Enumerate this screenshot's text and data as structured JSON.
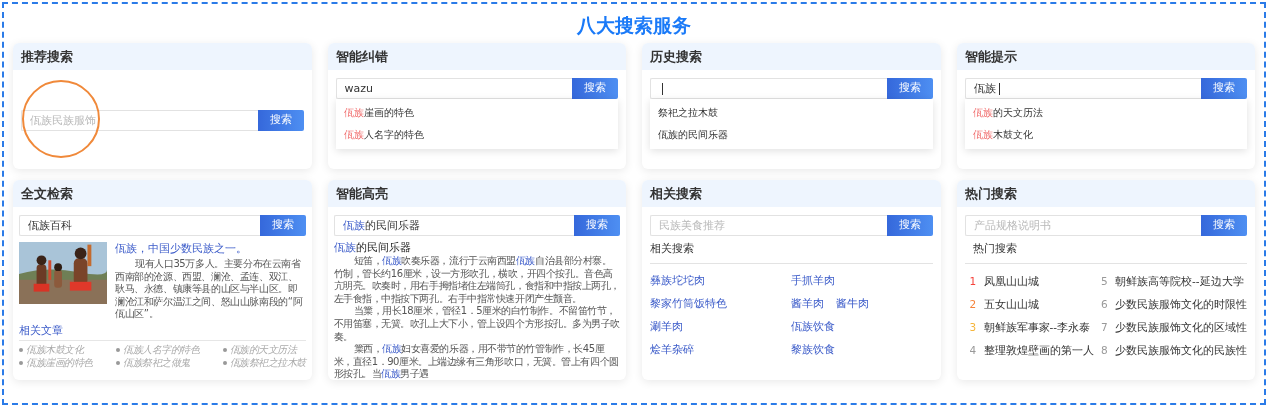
{
  "title": "八大搜索服务",
  "cards": [
    {
      "kind": "recommend",
      "title": "推荐搜索",
      "search": {
        "placeholder": "佤族民族服饰",
        "button": "搜索",
        "circled": true
      }
    },
    {
      "kind": "suggest",
      "title": "智能纠错",
      "search": {
        "value": "wazu",
        "button": "搜索"
      },
      "suggestions": [
        {
          "match": "佤族",
          "text": "崖画的特色"
        },
        {
          "match": "佤族",
          "text": "人名字的特色"
        }
      ]
    },
    {
      "kind": "suggest",
      "title": "历史搜索",
      "search": {
        "button": "搜索",
        "focused": true
      },
      "suggestions": [
        {
          "text": "祭祀之拉木鼓"
        },
        {
          "text": "佤族的民间乐器"
        }
      ]
    },
    {
      "kind": "suggest",
      "title": "智能提示",
      "search": {
        "value": "佤族",
        "button": "搜索",
        "focused": true
      },
      "suggestions": [
        {
          "match": "佤族",
          "text": "的天文历法"
        },
        {
          "match": "佤族",
          "text": "木鼓文化"
        }
      ]
    },
    {
      "kind": "fulltext",
      "title": "全文检索",
      "search": {
        "value": "佤族百科",
        "button": "搜索"
      },
      "result": {
        "title": "佤族，中国少数民族之一。",
        "text": "现有人口35万多人。主要分布在云南省西南部的沧源、西盟、澜沧、孟连、双江、耿马、永德、镇康等县的山区与半山区。即澜沧江和萨尔温江之间、怒山山脉南段的“阿佤山区”。"
      },
      "related_title": "相关文章",
      "articles": [
        "佤族木鼓文化",
        "佤族人名字的特色",
        "佤族的天文历法",
        "佤族崖画的特色",
        "佤族祭祀之做鬼",
        "佤族祭祀之拉木鼓"
      ]
    },
    {
      "kind": "highlight",
      "title": "智能高亮",
      "search": {
        "value_parts": [
          {
            "text": "佤族",
            "hl": true
          },
          {
            "text": "的民间乐器",
            "hl": false
          }
        ],
        "button": "搜索"
      },
      "heading": [
        {
          "text": "佤族",
          "hl": true
        },
        {
          "text": "的民间乐器",
          "hl": false
        }
      ],
      "paragraphs": [
        [
          {
            "text": "短笛，",
            "hl": false
          },
          {
            "text": "佤族",
            "hl": true
          },
          {
            "text": "吹奏乐器，流行于云南西盟",
            "hl": false
          },
          {
            "text": "佤族",
            "hl": true
          },
          {
            "text": "自治县部分村寨。竹制，管长约16厘米，设一方形吹孔，横吹，开四个按孔。音色高亢明亮。吹奏时，用右手拇指堵住左端筒孔，食指和中指按上两孔，左手食指，中指按下两孔。右手中指常快速开闭产生颤音。",
            "hl": false
          }
        ],
        [
          {
            "text": "当篥，用长18厘米，管径1．5厘米的白竹制作。不留笛竹节，不用笛塞，无簧。吹孔上大下小，管上设四个方形按孔。多为男子吹奏。",
            "hl": false
          }
        ],
        [
          {
            "text": "篥西，",
            "hl": false
          },
          {
            "text": "佤族",
            "hl": true
          },
          {
            "text": "妇女喜爱的乐器，用不带节的竹管制作，长45厘米，直径1．90厘米。上端边缘有三角形吹口，无簧。管上有四个圆形按孔。当",
            "hl": false
          },
          {
            "text": "佤族",
            "hl": true
          },
          {
            "text": "男子遇",
            "hl": false
          }
        ]
      ]
    },
    {
      "kind": "related",
      "title": "相关搜索",
      "search": {
        "placeholder": "民族美食推荐",
        "button": "搜索"
      },
      "heading": "相关搜索",
      "rows": [
        [
          [
            "彝族坨坨肉"
          ],
          [
            "手抓羊肉"
          ]
        ],
        [
          [
            "黎家竹筒饭特色"
          ],
          [
            "酱羊肉",
            "酱牛肉"
          ]
        ],
        [
          [
            "涮羊肉"
          ],
          [
            "佤族饮食"
          ]
        ],
        [
          [
            "烩羊杂碎"
          ],
          [
            "黎族饮食"
          ]
        ]
      ]
    },
    {
      "kind": "hot",
      "title": "热门搜索",
      "search": {
        "placeholder": "产品规格说明书",
        "button": "搜索"
      },
      "heading": "热门搜索",
      "items": [
        {
          "rank": "1",
          "text": "凤凰山山城",
          "color": "#f5423b"
        },
        {
          "rank": "2",
          "text": "五女山山城",
          "color": "#f5833b"
        },
        {
          "rank": "3",
          "text": "朝鲜族军事家--李永泰",
          "color": "#f5b53b"
        },
        {
          "rank": "4",
          "text": "整理敦煌壁画的第一人",
          "color": "#999999"
        },
        {
          "rank": "5",
          "text": "朝鲜族高等院校--延边大学",
          "color": "#999999"
        },
        {
          "rank": "6",
          "text": "少数民族服饰文化的时限性",
          "color": "#999999"
        },
        {
          "rank": "7",
          "text": "少数民族服饰文化的区域性",
          "color": "#999999"
        },
        {
          "rank": "8",
          "text": "少数民族服饰文化的民族性",
          "color": "#999999"
        }
      ]
    }
  ]
}
